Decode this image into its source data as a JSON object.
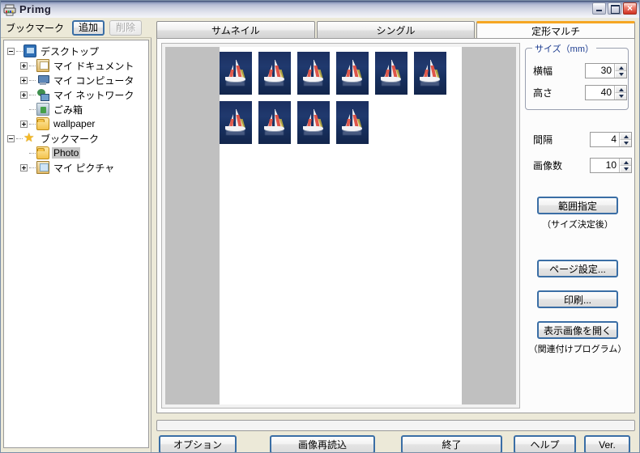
{
  "window": {
    "title": "Primg",
    "icon": "printer-icon",
    "minimize_label": "",
    "maximize_label": "",
    "close_label": "×"
  },
  "sidebar": {
    "bookmark_label": "ブックマーク",
    "add_button": "追加",
    "delete_button": "削除",
    "tree": [
      {
        "label": "デスクトップ",
        "icon": "desktop-icon",
        "indent": 0,
        "expander": "minus",
        "selected": false
      },
      {
        "label": "マイ ドキュメント",
        "icon": "documents-icon",
        "indent": 1,
        "expander": "plus",
        "selected": false
      },
      {
        "label": "マイ コンピュータ",
        "icon": "computer-icon",
        "indent": 1,
        "expander": "plus",
        "selected": false
      },
      {
        "label": "マイ ネットワーク",
        "icon": "network-icon",
        "indent": 1,
        "expander": "plus",
        "selected": false
      },
      {
        "label": "ごみ箱",
        "icon": "recycle-bin-icon",
        "indent": 1,
        "expander": "none",
        "selected": false
      },
      {
        "label": "wallpaper",
        "icon": "folder-icon",
        "indent": 1,
        "expander": "plus",
        "selected": false
      },
      {
        "label": "ブックマーク",
        "icon": "star-icon",
        "indent": 0,
        "expander": "minus",
        "selected": false
      },
      {
        "label": "Photo",
        "icon": "folder-icon",
        "indent": 1,
        "expander": "none",
        "selected": true
      },
      {
        "label": "マイ ピクチャ",
        "icon": "pictures-icon",
        "indent": 1,
        "expander": "plus",
        "selected": false
      }
    ]
  },
  "tabs": [
    {
      "label": "サムネイル",
      "active": false
    },
    {
      "label": "シングル",
      "active": false
    },
    {
      "label": "定形マルチ",
      "active": true
    }
  ],
  "preview": {
    "thumbnail_count": 10,
    "columns_row1": 6,
    "columns_row2": 4,
    "image_subject": "sailboat"
  },
  "controls": {
    "size_group_title": "サイズ（mm）",
    "width_label": "横幅",
    "width_value": "30",
    "height_label": "高さ",
    "height_value": "40",
    "spacing_label": "間隔",
    "spacing_value": "4",
    "count_label": "画像数",
    "count_value": "10",
    "range_button": "範囲指定",
    "range_note": "（サイズ決定後）",
    "page_setup_button": "ページ設定...",
    "print_button": "印刷...",
    "open_image_button": "表示画像を開く",
    "open_image_note": "（関連付けプログラム）"
  },
  "bottom_buttons": {
    "options": "オプション",
    "reload": "画像再読込",
    "exit": "終了",
    "help": "ヘルプ",
    "version": "Ver."
  },
  "statusbar": {
    "text": ""
  },
  "colors": {
    "accent_tab": "#f5a623",
    "group_title": "#1b3b8f",
    "button_border": "#3a6ea5",
    "thumb_water": "#1b2f60",
    "margin_band": "#c0c0c0"
  }
}
